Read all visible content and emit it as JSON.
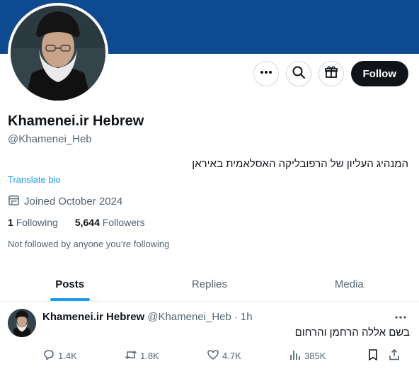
{
  "profile": {
    "name": "Khamenei.ir Hebrew",
    "handle": "@Khamenei_Heb",
    "bio": "המנהיג העליון של הרפובליקה האסלאמית באיראן",
    "translate_bio": "Translate bio",
    "joined": "Joined October 2024",
    "following_count": "1",
    "following_label": "Following",
    "followers_count": "5,644",
    "followers_label": "Followers",
    "not_followed": "Not followed by anyone you’re following",
    "banner_color": "#0d4a8f"
  },
  "actions": {
    "more_icon": "more-icon",
    "search_icon": "search-icon",
    "subscribe_icon": "gift-icon",
    "follow_label": "Follow"
  },
  "tabs": [
    {
      "label": "Posts",
      "active": true
    },
    {
      "label": "Replies",
      "active": false
    },
    {
      "label": "Media",
      "active": false
    }
  ],
  "tweet": {
    "name": "Khamenei.ir Hebrew",
    "handle": "@Khamenei_Heb",
    "separator": "·",
    "time": "1h",
    "text": "בשם אללה הרחמן והרחום",
    "replies": "1.4K",
    "retweets": "1.8K",
    "likes": "4.7K",
    "views": "385K"
  },
  "colors": {
    "accent": "#1d9bf0",
    "text": "#0f1419",
    "secondary": "#536471"
  }
}
